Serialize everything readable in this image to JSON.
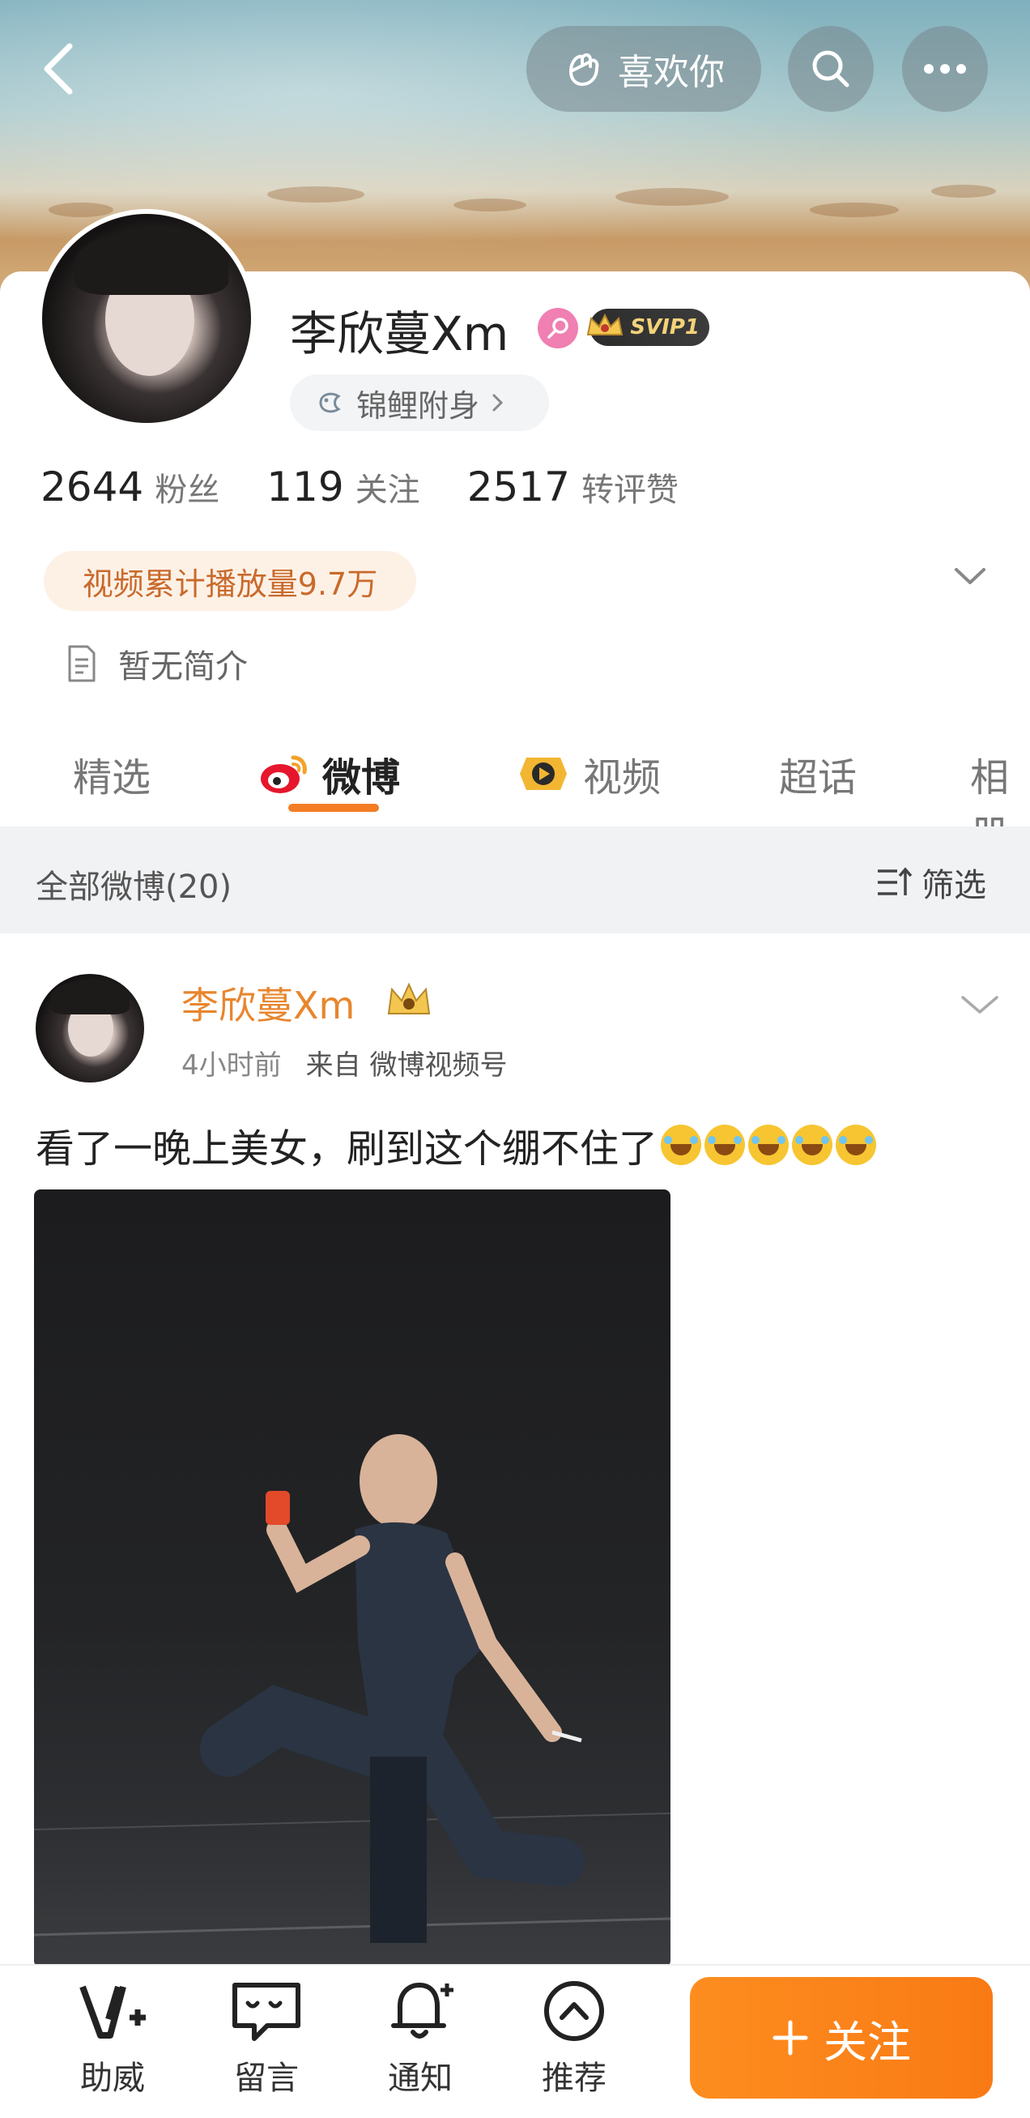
{
  "header": {
    "like_label": "喜欢你"
  },
  "profile": {
    "username": "李欣蔓Xm",
    "vip_badge": "SVIP1",
    "luck_label": "锦鲤附身",
    "stats": [
      {
        "value": "2644",
        "label": "粉丝"
      },
      {
        "value": "119",
        "label": "关注"
      },
      {
        "value": "2517",
        "label": "转评赞"
      }
    ],
    "video_plays": "视频累计播放量9.7万",
    "bio": "暂无简介"
  },
  "tabs": [
    {
      "label": "精选"
    },
    {
      "label": "微博"
    },
    {
      "label": "视频"
    },
    {
      "label": "超话"
    },
    {
      "label": "相册"
    }
  ],
  "filter": {
    "title": "全部微博(20)",
    "button_label": "筛选"
  },
  "post": {
    "author": "李欣蔓Xm",
    "time": "4小时前",
    "source": "来自 微博视频号",
    "text": "看了一晚上美女，刷到这个绷不住了"
  },
  "bottom_bar": {
    "items": [
      {
        "label": "助威",
        "icon": "boost-icon"
      },
      {
        "label": "留言",
        "icon": "message-icon"
      },
      {
        "label": "通知",
        "icon": "bell-icon"
      },
      {
        "label": "推荐",
        "icon": "recommend-icon"
      }
    ],
    "follow_label": "关注"
  },
  "colors": {
    "accent": "#f47c24",
    "author_name": "#e8862e",
    "female_badge": "#f07fb2"
  }
}
